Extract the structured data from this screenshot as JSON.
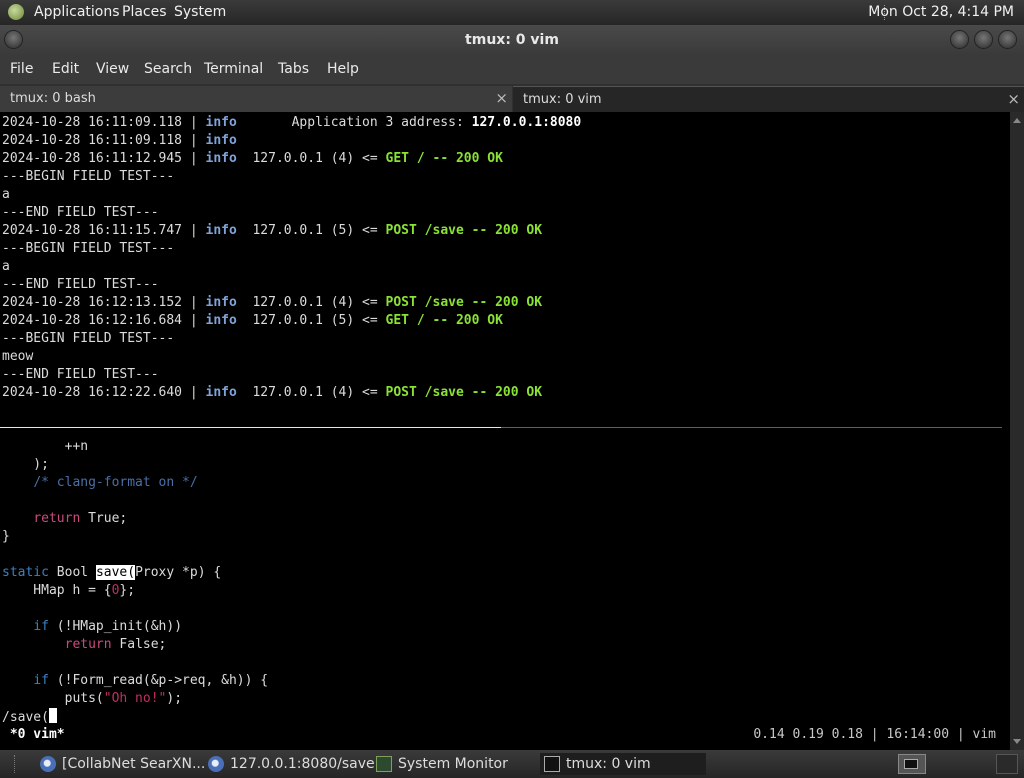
{
  "top_panel": {
    "menus": [
      "Applications",
      "Places",
      "System"
    ],
    "clock": "Mon Oct 28,  4:14 PM"
  },
  "window": {
    "title": "tmux: 0 vim"
  },
  "menubar": [
    "File",
    "Edit",
    "View",
    "Search",
    "Terminal",
    "Tabs",
    "Help"
  ],
  "tabs": [
    {
      "label": "tmux: 0 bash",
      "close": "×"
    },
    {
      "label": "tmux: 0 vim",
      "close": "×"
    }
  ],
  "terminal": {
    "log": {
      "l1_ts": "2024-10-28 16:11:09.118 | ",
      "l1_lvl": "info",
      "l1_msg": "       Application 3 address: ",
      "l1_addr": "127.0.0.1:8080",
      "l2_ts": "2024-10-28 16:11:09.118 | ",
      "l2_lvl": "info",
      "l3_ts": "2024-10-28 16:11:12.945 | ",
      "l3_lvl": "info",
      "l3_msg": "  127.0.0.1 (4) <= ",
      "l3_req": "GET / -- 200 OK",
      "l4": "---BEGIN FIELD TEST---",
      "l5": "a",
      "l6": "---END FIELD TEST---",
      "l7_ts": "2024-10-28 16:11:15.747 | ",
      "l7_lvl": "info",
      "l7_msg": "  127.0.0.1 (5) <= ",
      "l7_req": "POST /save -- 200 OK",
      "l8": "---BEGIN FIELD TEST---",
      "l9": "a",
      "l10": "---END FIELD TEST---",
      "l11_ts": "2024-10-28 16:12:13.152 | ",
      "l11_lvl": "info",
      "l11_msg": "  127.0.0.1 (4) <= ",
      "l11_req": "POST /save -- 200 OK",
      "l12_ts": "2024-10-28 16:12:16.684 | ",
      "l12_lvl": "info",
      "l12_msg": "  127.0.0.1 (5) <= ",
      "l12_req": "GET / -- 200 OK",
      "l13": "---BEGIN FIELD TEST---",
      "l14": "meow",
      "l15": "---END FIELD TEST---",
      "l16_ts": "2024-10-28 16:12:22.640 | ",
      "l16_lvl": "info",
      "l16_msg": "  127.0.0.1 (4) <= ",
      "l16_req": "POST /save -- 200 OK"
    },
    "code": {
      "c1": "        ++n",
      "c2": "    );",
      "c3_ind": "    ",
      "c3_cmt": "/* clang-format on */",
      "c5_ind": "    ",
      "c5_kw": "return",
      "c5_rest": " True;",
      "c6": "}",
      "c8_kw": "static",
      "c8_a": " Bool ",
      "c8_hl": "save(",
      "c8_b": "Proxy *p) {",
      "c9_a": "    HMap h = {",
      "c9_num": "0",
      "c9_b": "};",
      "c11_ind": "    ",
      "c11_kw": "if",
      "c11_rest": " (!HMap_init(&h))",
      "c12_ind": "        ",
      "c12_kw": "return",
      "c12_rest": " False;",
      "c14_ind": "    ",
      "c14_kw": "if",
      "c14_rest": " (!Form_read(&p->req, &h)) {",
      "c15_a": "        puts(",
      "c15_str": "\"Oh no!\"",
      "c15_b": ");",
      "search": "/save("
    },
    "status": {
      "left": " *0 vim*",
      "right": "0.14 0.19 0.18 | 16:14:00 | vim"
    }
  },
  "taskbar": [
    {
      "label": "[CollabNet SearXN...",
      "icon": "chromium-icon"
    },
    {
      "label": "127.0.0.1:8080/save ...",
      "icon": "chromium-icon"
    },
    {
      "label": "System Monitor",
      "icon": "system-monitor-icon"
    },
    {
      "label": "tmux: 0 vim",
      "icon": "terminal-icon"
    }
  ],
  "colors": {
    "info": "#7fa3d8",
    "ok": "#8ae234",
    "keyword": "#3e7fbf",
    "return_kw": "#c94b7d",
    "comment": "#4a6fa8",
    "string": "#c0305a"
  }
}
